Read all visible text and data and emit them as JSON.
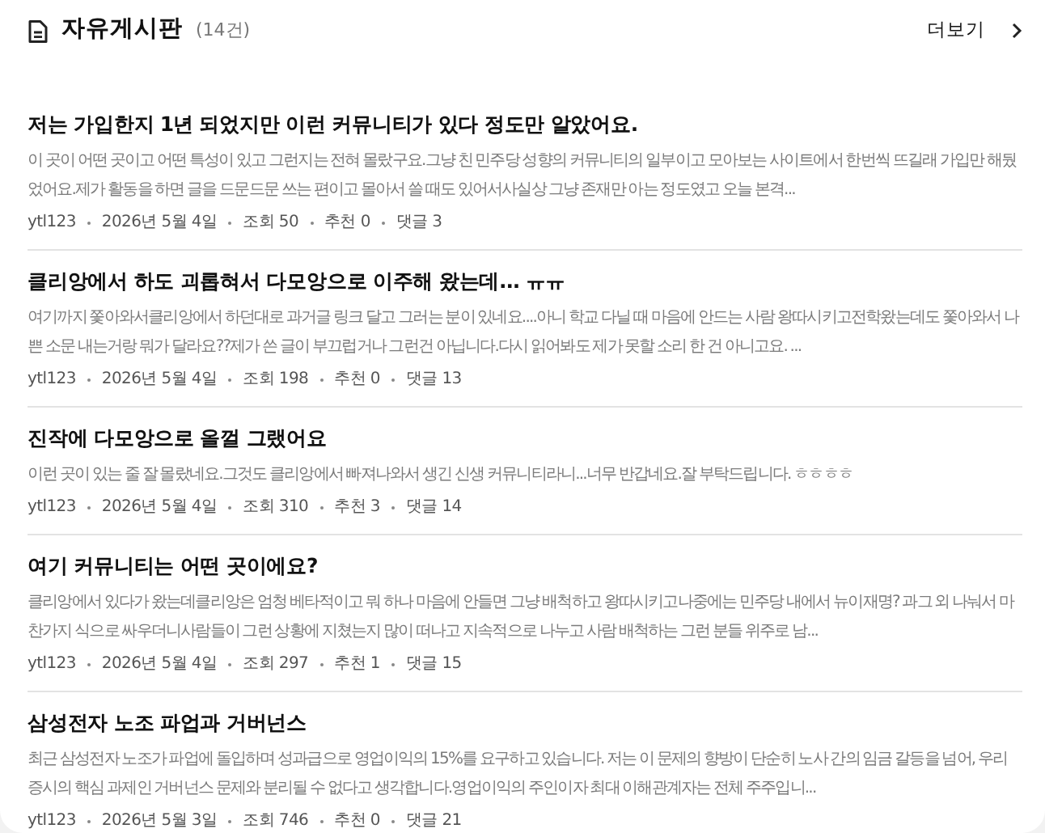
{
  "board": {
    "title": "자유게시판",
    "count": "(14건)",
    "more": "더보기"
  },
  "posts": [
    {
      "title": "저는 가입한지 1년 되었지만 이런 커뮤니티가 있다 정도만 알았어요.",
      "excerpt": "이 곳이 어떤 곳이고 어떤 특성이 있고 그런지는 전혀 몰랐구요.그냥 친 민주당 성향의 커뮤니티의 일부이고 모아보는 사이트에서 한번씩 뜨길래 가입만 해뒀었어요.제가 활동을 하면 글을 드문드문 쓰는 편이고 몰아서 쓸 때도 있어서사실상 그냥 존재만 아는 정도였고 오늘 본격...",
      "meta": [
        "ytl123",
        "2026년 5월 4일",
        "조회 50",
        "추천 0",
        "댓글 3"
      ]
    },
    {
      "title": "클리앙에서 하도 괴롭혀서 다모앙으로 이주해 왔는데... ㅠㅠ",
      "excerpt": "여기까지 쫓아와서클리앙에서 하던대로 과거글 링크 달고 그러는 분이 있네요....아니 학교 다닐 때 마음에 안드는 사람 왕따시키고전학왔는데도 쫓아와서 나쁜 소문 내는거랑 뭐가 달라요??제가 쓴 글이 부끄럽거나 그런건 아닙니다.다시 읽어봐도 제가 못할 소리 한 건 아니고요. ...",
      "meta": [
        "ytl123",
        "2026년 5월 4일",
        "조회 198",
        "추천 0",
        "댓글 13"
      ]
    },
    {
      "title": "진작에 다모앙으로 올껄 그랬어요",
      "excerpt": "이런 곳이 있는 줄 잘 몰랐네요.그것도 클리앙에서 빠져나와서 생긴 신생 커뮤니티라니...너무 반갑네요.잘 부탁드립니다. ㅎㅎㅎㅎ",
      "meta": [
        "ytl123",
        "2026년 5월 4일",
        "조회 310",
        "추천 3",
        "댓글 14"
      ]
    },
    {
      "title": "여기 커뮤니티는 어떤 곳이에요?",
      "excerpt": "클리앙에서 있다가 왔는데클리앙은 엄청 베타적이고 뭐 하나 마음에 안들면 그냥 배척하고 왕따시키고나중에는 민주당 내에서 뉴이재명? 과그 외 나눠서 마찬가지 식으로 싸우더니사람들이 그런 상황에 지쳤는지 많이 떠나고 지속적으로 나누고 사람 배척하는 그런 분들 위주로 남...",
      "meta": [
        "ytl123",
        "2026년 5월 4일",
        "조회 297",
        "추천 1",
        "댓글 15"
      ]
    },
    {
      "title": "삼성전자 노조 파업과 거버넌스",
      "excerpt": "최근 삼성전자 노조가 파업에 돌입하며 성과급으로 영업이익의 15%를 요구하고 있습니다. 저는 이 문제의 향방이 단순히 노사 간의 임금 갈등을 넘어, 우리 증시의 핵심 과제인 거버넌스 문제와 분리될 수 없다고 생각합니다.영업이익의 주인이자 최대 이해관계자는 전체 주주입니...",
      "meta": [
        "ytl123",
        "2026년 5월 3일",
        "조회 746",
        "추천 0",
        "댓글 21"
      ]
    }
  ]
}
